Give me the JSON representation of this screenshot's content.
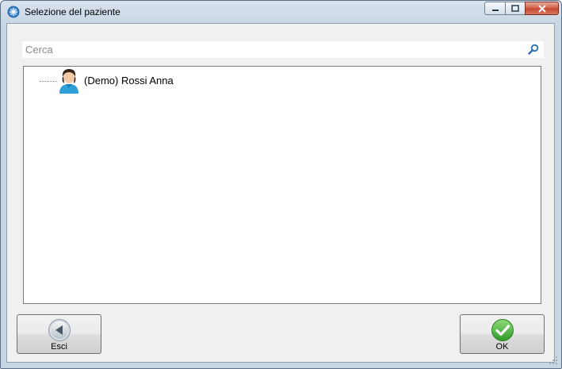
{
  "window": {
    "title": "Selezione del paziente"
  },
  "search": {
    "placeholder": "Cerca",
    "value": ""
  },
  "tree": {
    "items": [
      {
        "label": "(Demo) Rossi Anna",
        "icon": "person-icon"
      }
    ]
  },
  "buttons": {
    "esci": {
      "label": "Esci",
      "icon": "back-arrow-icon"
    },
    "ok": {
      "label": "OK",
      "icon": "check-icon"
    }
  },
  "colors": {
    "accent": "#2a6fb6",
    "ok_green": "#3aa335",
    "close_red": "#c44a32"
  }
}
